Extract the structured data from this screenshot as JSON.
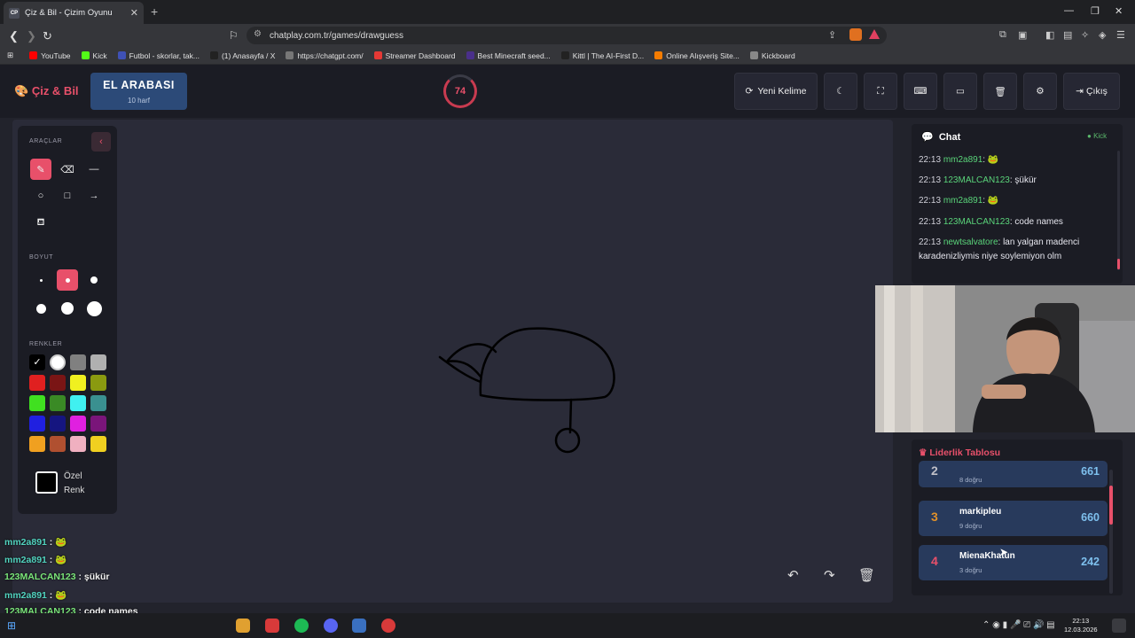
{
  "browser": {
    "tab_title": "Çiz & Bil - Çizim Oyunu",
    "favicon_text": "CP",
    "url": "chatplay.com.tr/games/drawguess",
    "bookmarks": [
      {
        "label": "YouTube",
        "color": "#ff0000"
      },
      {
        "label": "Kick",
        "color": "#53fc18"
      },
      {
        "label": "Futbol - skorlar, tak...",
        "color": "#3f51b5"
      },
      {
        "label": "(1) Anasayfa / X",
        "color": "#222222"
      },
      {
        "label": "https://chatgpt.com/",
        "color": "#777777"
      },
      {
        "label": "Streamer Dashboard",
        "color": "#e53935"
      },
      {
        "label": "Best Minecraft seed...",
        "color": "#4a2f8a"
      },
      {
        "label": "Kittl | The AI-First D...",
        "color": "#222222"
      },
      {
        "label": "Online Alışveriş Site...",
        "color": "#f57c00"
      },
      {
        "label": "Kickboard",
        "color": "#888888"
      }
    ]
  },
  "header": {
    "logo": "Çiz & Bil",
    "word": "EL ARABASI",
    "letters": "10 harf",
    "timer": "74",
    "new_word": "Yeni Kelime",
    "exit": "Çıkış"
  },
  "tools": {
    "title": "ARAÇLAR",
    "size_title": "BOYUT",
    "colors_title": "RENKLER",
    "custom_line1": "Özel",
    "custom_line2": "Renk",
    "palette": [
      "#000000",
      "#ffffff",
      "#808080",
      "#b0b0b0",
      "#e02020",
      "#7a1515",
      "#f0f020",
      "#8a9a10",
      "#40e020",
      "#3a8a25",
      "#40f0f0",
      "#3a9090",
      "#2020e0",
      "#151580",
      "#e020e0",
      "#7a157a",
      "#f0a020",
      "#b05030",
      "#f0b0c0",
      "#f0d020"
    ]
  },
  "overlay_chat": [
    {
      "user": "mm2a891",
      "msg": "🐸",
      "style": "u2"
    },
    {
      "user": "mm2a891",
      "msg": "🐸",
      "style": "u2"
    },
    {
      "user": "123MALCAN123",
      "msg": "şükür",
      "style": "u"
    },
    {
      "user": "mm2a891",
      "msg": "🐸",
      "style": "u2"
    },
    {
      "user": "123MALCAN123",
      "msg": "code names",
      "style": "u"
    },
    {
      "user": "newtsalvatore",
      "msg": "lan yalgan madenci karadenizliymis niye soylemiyon olm",
      "style": "u"
    }
  ],
  "chat": {
    "title": "Chat",
    "source": "Kick",
    "messages": [
      {
        "time": "22:13",
        "user": "mm2a891",
        "msg": "🐸"
      },
      {
        "time": "22:13",
        "user": "123MALCAN123",
        "msg": "şükür"
      },
      {
        "time": "22:13",
        "user": "mm2a891",
        "msg": "🐸"
      },
      {
        "time": "22:13",
        "user": "123MALCAN123",
        "msg": "code names"
      },
      {
        "time": "22:13",
        "user": "newtsalvatore",
        "msg": "lan yalgan madenci karadenizliymis niye soylemiyon olm"
      }
    ]
  },
  "leaderboard": {
    "title": "Liderlik Tablosu",
    "rows": [
      {
        "rank": "2",
        "name": "",
        "correct": "8 doğru",
        "points": "661",
        "rank_color": "#c0c0c8"
      },
      {
        "rank": "3",
        "name": "markipleu",
        "correct": "9 doğru",
        "points": "660",
        "rank_color": "#e0902a"
      },
      {
        "rank": "4",
        "name": "MienaKhatun",
        "correct": "3 doğru",
        "points": "242",
        "rank_color": "#e8506a"
      }
    ]
  },
  "taskbar": {
    "time": "22:13",
    "date": "12.03.2026"
  }
}
